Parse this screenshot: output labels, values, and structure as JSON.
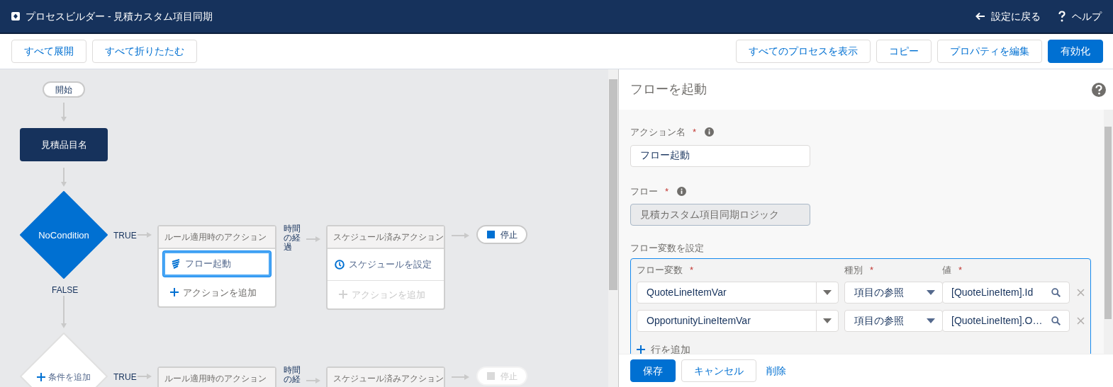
{
  "header": {
    "title": "プロセスビルダー - 見積カスタム項目同期",
    "links": [
      {
        "kind": "back",
        "label": "設定に戻る"
      },
      {
        "kind": "help",
        "label": "ヘルプ"
      }
    ]
  },
  "toolbar": {
    "left_buttons": [
      {
        "label": "すべて展開",
        "kind": "neutral"
      },
      {
        "label": "すべて折りたたむ",
        "kind": "neutral"
      }
    ],
    "right_buttons": [
      {
        "label": "すべてのプロセスを表示",
        "kind": "neutral"
      },
      {
        "label": "コピー",
        "kind": "neutral"
      },
      {
        "label": "プロパティを編集",
        "kind": "neutral"
      },
      {
        "label": "有効化",
        "kind": "brand"
      }
    ]
  },
  "canvas": {
    "start": "開始",
    "criteria": "見積品目名",
    "branches": [
      {
        "kind": "condition",
        "condition": "NoCondition",
        "true_label": "TRUE",
        "false_label": "FALSE",
        "immediate": {
          "header": "ルール適用時のアクション",
          "actions": [
            {
              "label": "フロー起動",
              "selected": true
            }
          ],
          "add_action": {
            "label": "アクションを追加",
            "disabled": false
          }
        },
        "time_label": "時間の経過",
        "scheduled": {
          "header": "スケジュール済みアクション",
          "set_schedule": "スケジュールを設定",
          "add_action": {
            "label": "アクションを追加",
            "disabled": true
          }
        },
        "stop": {
          "label": "停止",
          "disabled": false
        }
      },
      {
        "kind": "add",
        "condition": "条件を追加",
        "true_label": "TRUE",
        "immediate": {
          "header": "ルール適用時のアクション"
        },
        "time_label": "時間の経",
        "scheduled": {
          "header": "スケジュール済みアクション"
        },
        "stop": {
          "label": "停止",
          "disabled": true
        }
      }
    ]
  },
  "panel": {
    "title": "フローを起動",
    "fields": [
      {
        "label": "アクション名",
        "required_mark": "*",
        "info": true,
        "value": "フロー起動",
        "disabled": false
      },
      {
        "label": "フロー",
        "required_mark": "*",
        "info": true,
        "value": "見積カスタム項目同期ロジック",
        "disabled": true
      }
    ],
    "variables": {
      "label": "フロー変数を設定",
      "columns": [
        {
          "label": "フロー変数",
          "required_mark": "*"
        },
        {
          "label": "種別",
          "required_mark": "*"
        },
        {
          "label": "値",
          "required_mark": "*"
        }
      ],
      "rows": [
        {
          "variable": "QuoteLineItemVar",
          "type": "項目の参照",
          "value": "[QuoteLineItem].Id"
        },
        {
          "variable": "OpportunityLineItemVar",
          "type": "項目の参照",
          "value": "[QuoteLineItem].O…"
        }
      ],
      "add_row": "行を追加"
    },
    "footer": [
      {
        "label": "保存",
        "kind": "brand"
      },
      {
        "label": "キャンセル",
        "kind": "neutral"
      },
      {
        "label": "削除",
        "kind": "link"
      }
    ]
  }
}
